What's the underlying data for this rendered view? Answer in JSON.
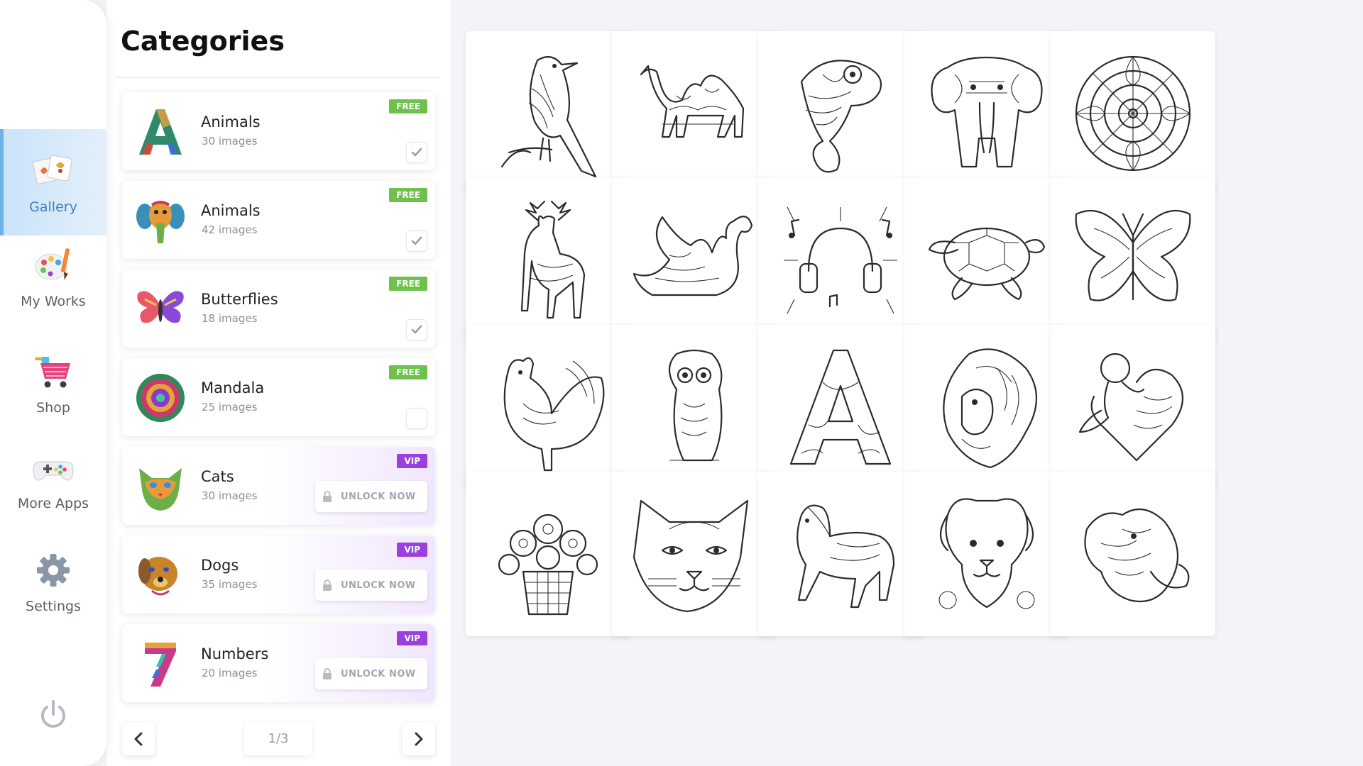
{
  "nav": {
    "items": [
      {
        "label": "Gallery",
        "icon": "gallery-icon",
        "active": true
      },
      {
        "label": "My Works",
        "icon": "palette-icon",
        "active": false
      },
      {
        "label": "Shop",
        "icon": "shopping-cart-icon",
        "active": false
      },
      {
        "label": "More Apps",
        "icon": "gamepad-icon",
        "active": false
      },
      {
        "label": "Settings",
        "icon": "gear-icon",
        "active": false
      }
    ],
    "power_icon": "power-icon"
  },
  "categories": {
    "title": "Categories",
    "items": [
      {
        "name": "Animals",
        "count": "30 images",
        "badge": "FREE",
        "type": "free",
        "checked": true,
        "thumb": "letter-a"
      },
      {
        "name": "Animals",
        "count": "42 images",
        "badge": "FREE",
        "type": "free",
        "checked": true,
        "thumb": "elephant"
      },
      {
        "name": "Butterflies",
        "count": "18 images",
        "badge": "FREE",
        "type": "free",
        "checked": true,
        "thumb": "butterfly"
      },
      {
        "name": "Mandala",
        "count": "25 images",
        "badge": "FREE",
        "type": "free",
        "checked": false,
        "thumb": "mandala"
      },
      {
        "name": "Cats",
        "count": "30 images",
        "badge": "VIP",
        "type": "vip",
        "unlock_label": "UNLOCK NOW",
        "thumb": "cat"
      },
      {
        "name": "Dogs",
        "count": "35 images",
        "badge": "VIP",
        "type": "vip",
        "unlock_label": "UNLOCK NOW",
        "thumb": "dog"
      },
      {
        "name": "Numbers",
        "count": "20 images",
        "badge": "VIP",
        "type": "vip",
        "unlock_label": "UNLOCK NOW",
        "thumb": "number-seven"
      }
    ],
    "pager": {
      "label": "1/3",
      "prev_icon": "chevron-left-icon",
      "next_icon": "chevron-right-icon"
    }
  },
  "gallery": {
    "tiles": [
      "bird",
      "camel",
      "chameleon",
      "elephant",
      "mandala",
      "deer",
      "swan",
      "music-headphones",
      "turtle",
      "butterfly",
      "rooster",
      "owl",
      "letter-a",
      "lion",
      "cherub-heart",
      "flower-basket",
      "cat-face",
      "horse",
      "puppy",
      "elephant-mask"
    ]
  },
  "colors": {
    "free_badge": "#6cc24a",
    "vip_badge": "#9a3fe0",
    "active_nav": "#c9e3fa",
    "background": "#f3f4f8"
  }
}
